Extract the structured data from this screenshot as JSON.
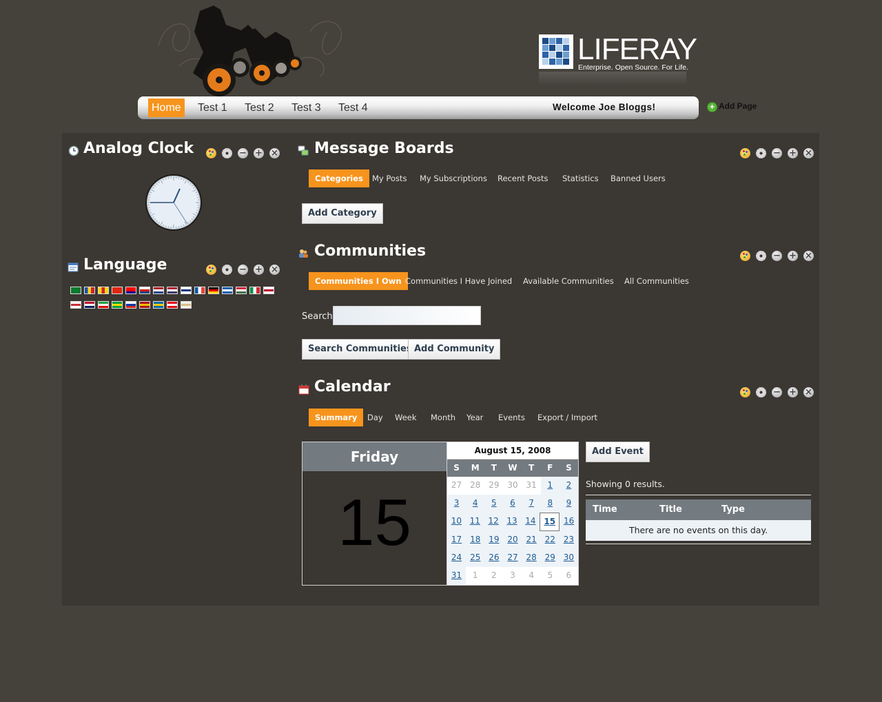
{
  "logo": {
    "text": "LIFERAY",
    "tagline": "Enterprise. Open Source. For Life."
  },
  "nav": {
    "items": [
      "Home",
      "Test 1",
      "Test 2",
      "Test 3",
      "Test 4"
    ],
    "welcome": "Welcome Joe Bloggs!",
    "add_page": "Add Page"
  },
  "portlets": {
    "clock": {
      "title": "Analog Clock",
      "icon": "clock-icon",
      "time_shown": "2:46"
    },
    "language": {
      "title": "Language",
      "icon": "language-icon",
      "flags": [
        "ar_SA",
        "ca_AD",
        "ca_ES",
        "zh_CN",
        "zh_TW",
        "cs_CZ",
        "nl_NL",
        "en_US",
        "fi_FI",
        "fr_FR",
        "de_DE",
        "el_GR",
        "hu_HU",
        "it_IT",
        "ja_JP",
        "ko_KR",
        "nb_NO",
        "fa_IR",
        "pt_BR",
        "ru_RU",
        "es_ES",
        "sv_SE",
        "tr_TR",
        "vi_VN"
      ]
    },
    "message_boards": {
      "title": "Message Boards",
      "icon": "message-boards-icon",
      "tabs": [
        "Categories",
        "My Posts",
        "My Subscriptions",
        "Recent Posts",
        "Statistics",
        "Banned Users"
      ],
      "add_button": "Add Category"
    },
    "communities": {
      "title": "Communities",
      "icon": "communities-icon",
      "tabs": [
        "Communities I Own",
        "Communities I Have Joined",
        "Available Communities",
        "All Communities"
      ],
      "search_label": "Search",
      "search_value": "",
      "search_button": "Search Communities",
      "add_button": "Add Community"
    },
    "calendar": {
      "title": "Calendar",
      "icon": "calendar-icon",
      "tabs": [
        "Summary",
        "Day",
        "Week",
        "Month",
        "Year",
        "Events",
        "Export / Import"
      ],
      "day_name": "Friday",
      "day_number": "15",
      "month_title": "August 15, 2008",
      "weekdays": [
        "S",
        "M",
        "T",
        "W",
        "T",
        "F",
        "S"
      ],
      "weeks": [
        [
          "27",
          "28",
          "29",
          "30",
          "31",
          "1",
          "2"
        ],
        [
          "3",
          "4",
          "5",
          "6",
          "7",
          "8",
          "9"
        ],
        [
          "10",
          "11",
          "12",
          "13",
          "14",
          "15",
          "16"
        ],
        [
          "17",
          "18",
          "19",
          "20",
          "21",
          "22",
          "23"
        ],
        [
          "24",
          "25",
          "26",
          "27",
          "28",
          "29",
          "30"
        ],
        [
          "31",
          "1",
          "2",
          "3",
          "4",
          "5",
          "6"
        ]
      ],
      "add_button": "Add Event",
      "showing": "Showing 0 results.",
      "columns": [
        "Time",
        "Title",
        "Type"
      ],
      "empty": "There are no events on this day."
    }
  },
  "colors": {
    "accent": "#f7941d",
    "page_bg": "#45413b",
    "panel_bg": "#3b3732",
    "table_header": "#737a80"
  }
}
